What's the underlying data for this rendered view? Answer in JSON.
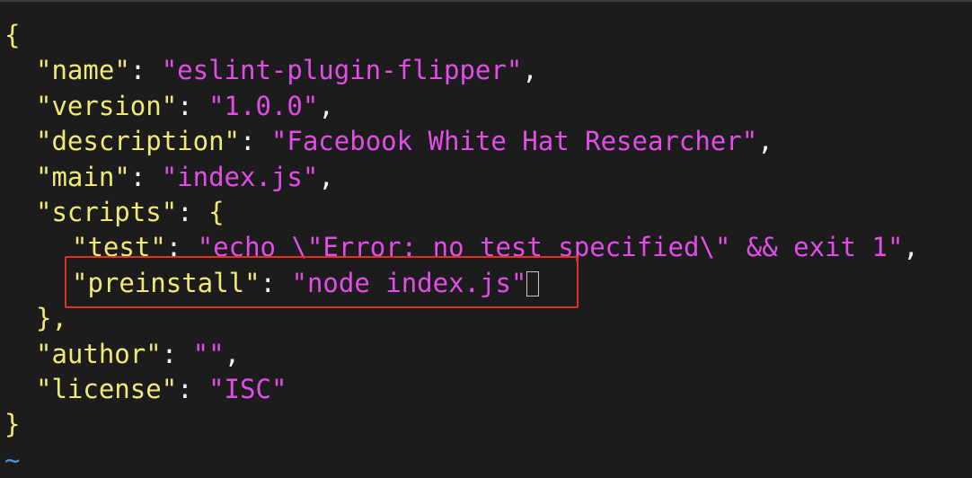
{
  "colors": {
    "background": "#1c1c1c",
    "key": "#f0ea74",
    "string": "#e14de6",
    "punctuation": "#f3f3f3",
    "tilde": "#4e8fe3",
    "highlight": "#e0301e"
  },
  "tokens": {
    "open_brace": "{",
    "close_brace": "}",
    "close_scripts": "},",
    "colon": ": ",
    "comma": ",",
    "quote": "\"",
    "tilde": "~"
  },
  "package": {
    "name_key": "name",
    "name_value": "eslint-plugin-flipper",
    "version_key": "version",
    "version_value": "1.0.0",
    "description_key": "description",
    "description_value": "Facebook White Hat Researcher",
    "main_key": "main",
    "main_value": "index.js",
    "scripts_key": "scripts",
    "scripts_open": "{",
    "test_key": "test",
    "test_value": "echo \\\"Error: no test specified\\\" && exit 1",
    "preinstall_key": "preinstall",
    "preinstall_value": "node index.js",
    "author_key": "author",
    "author_value": "",
    "license_key": "license",
    "license_value": "ISC"
  }
}
